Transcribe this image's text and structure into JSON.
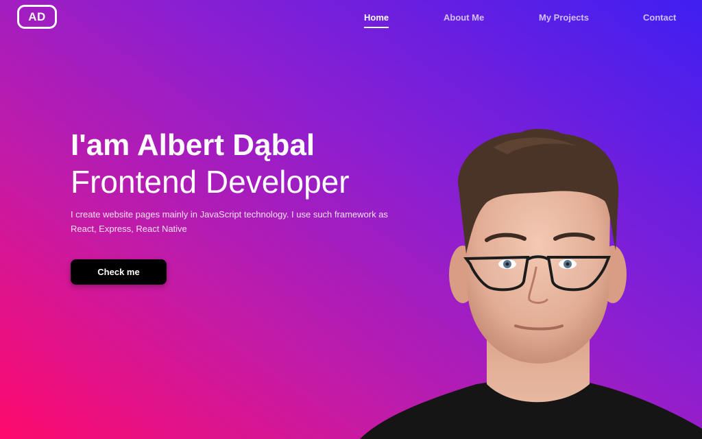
{
  "logo": {
    "text": "AD"
  },
  "nav": {
    "items": [
      {
        "label": "Home",
        "active": true
      },
      {
        "label": "About Me",
        "active": false
      },
      {
        "label": "My Projects",
        "active": false
      },
      {
        "label": "Contact",
        "active": false
      }
    ]
  },
  "hero": {
    "heading": "I'am Albert Dąbal",
    "subheading": "Frontend Developer",
    "description": "I create website pages mainly in JavaScript technology. I use such framework as React, Express, React Native",
    "cta_label": "Check me"
  },
  "colors": {
    "gradient_start": "#ff0a6c",
    "gradient_mid": "#8a1fd2",
    "gradient_end": "#3f1ff2",
    "button_bg": "#000000"
  }
}
